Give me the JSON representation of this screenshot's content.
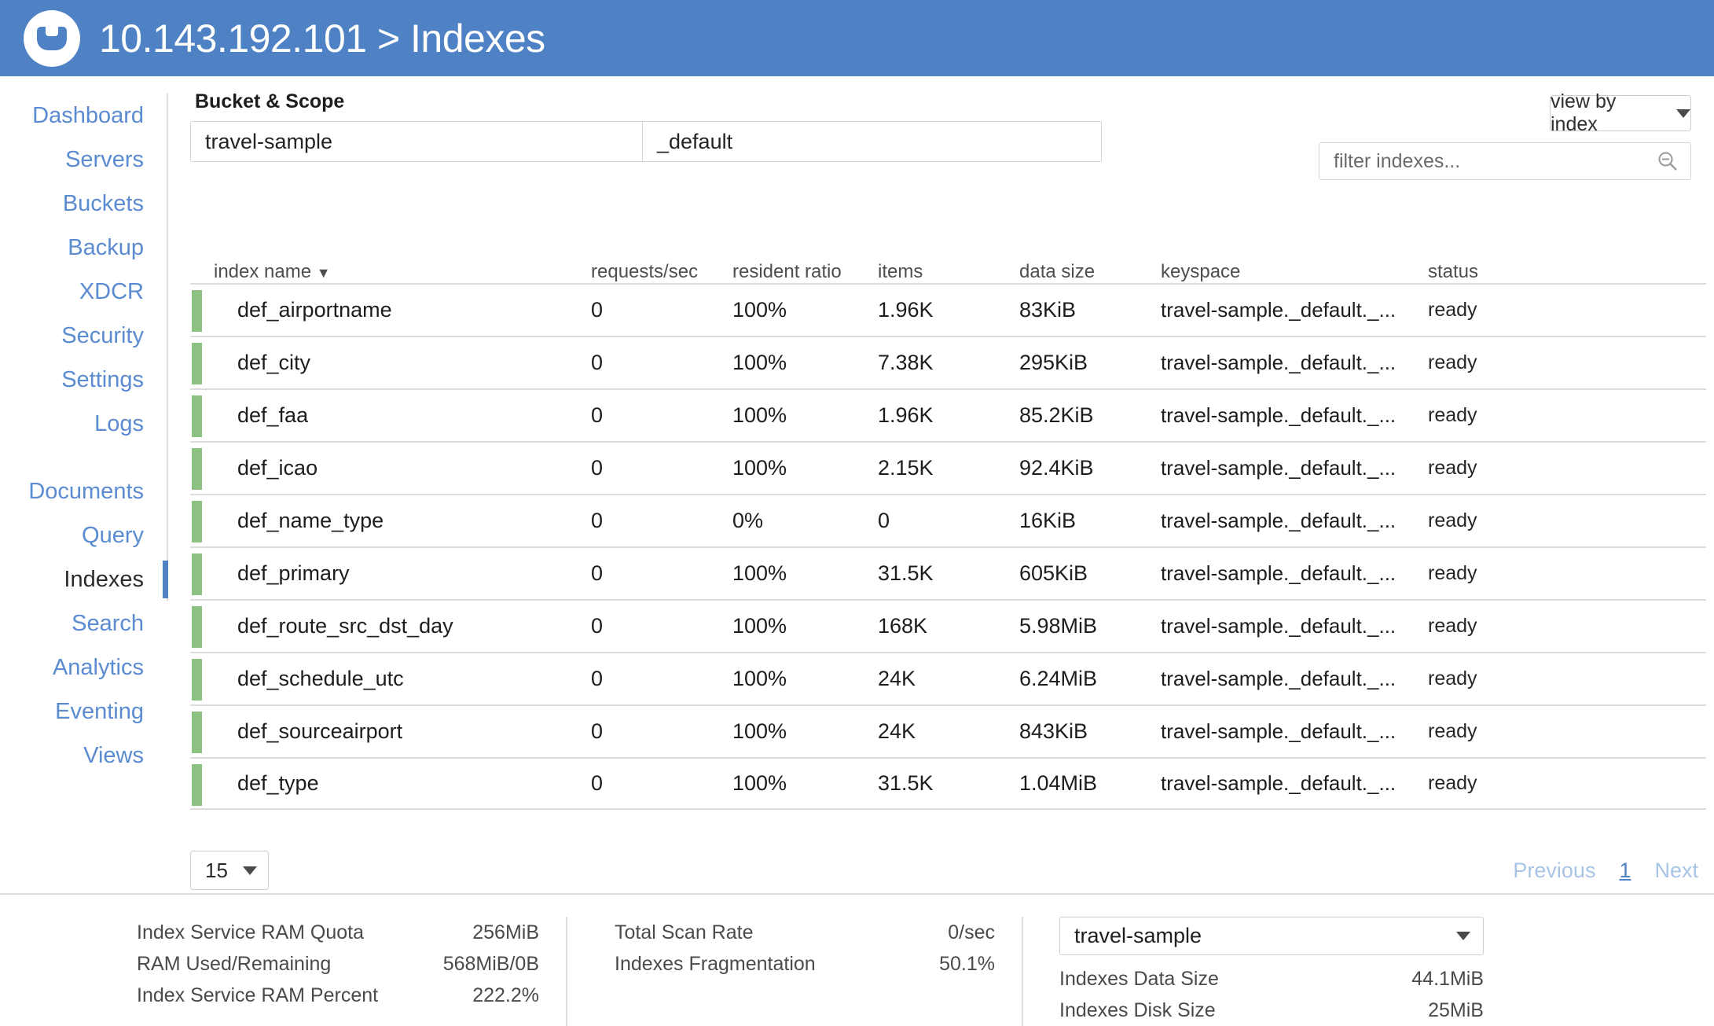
{
  "header": {
    "title": "10.143.192.101 > Indexes",
    "logo_icon": "couchbase-logo-icon",
    "bg_color": "#4f82c4"
  },
  "sidebar": {
    "group1": [
      {
        "label": "Dashboard",
        "active": false
      },
      {
        "label": "Servers",
        "active": false
      },
      {
        "label": "Buckets",
        "active": false
      },
      {
        "label": "Backup",
        "active": false
      },
      {
        "label": "XDCR",
        "active": false
      },
      {
        "label": "Security",
        "active": false
      },
      {
        "label": "Settings",
        "active": false
      },
      {
        "label": "Logs",
        "active": false
      }
    ],
    "group2": [
      {
        "label": "Documents",
        "active": false
      },
      {
        "label": "Query",
        "active": false
      },
      {
        "label": "Indexes",
        "active": true
      },
      {
        "label": "Search",
        "active": false
      },
      {
        "label": "Analytics",
        "active": false
      },
      {
        "label": "Eventing",
        "active": false
      },
      {
        "label": "Views",
        "active": false
      }
    ]
  },
  "controls": {
    "bucket_scope_label": "Bucket & Scope",
    "bucket_value": "travel-sample",
    "scope_value": "_default",
    "view_by_label": "view by index",
    "filter_placeholder": "filter indexes...",
    "filter_value": "",
    "search_icon": "search-icon"
  },
  "table": {
    "columns": [
      "index name",
      "requests/sec",
      "resident ratio",
      "items",
      "data size",
      "keyspace",
      "status"
    ],
    "sort_indicator": "▼",
    "status_color": "#8cc182",
    "rows": [
      {
        "name": "def_airportname",
        "requests": "0",
        "resident": "100%",
        "items": "1.96K",
        "size": "83KiB",
        "keyspace": "travel-sample._default._...",
        "status": "ready"
      },
      {
        "name": "def_city",
        "requests": "0",
        "resident": "100%",
        "items": "7.38K",
        "size": "295KiB",
        "keyspace": "travel-sample._default._...",
        "status": "ready"
      },
      {
        "name": "def_faa",
        "requests": "0",
        "resident": "100%",
        "items": "1.96K",
        "size": "85.2KiB",
        "keyspace": "travel-sample._default._...",
        "status": "ready"
      },
      {
        "name": "def_icao",
        "requests": "0",
        "resident": "100%",
        "items": "2.15K",
        "size": "92.4KiB",
        "keyspace": "travel-sample._default._...",
        "status": "ready"
      },
      {
        "name": "def_name_type",
        "requests": "0",
        "resident": "0%",
        "items": "0",
        "size": "16KiB",
        "keyspace": "travel-sample._default._...",
        "status": "ready"
      },
      {
        "name": "def_primary",
        "requests": "0",
        "resident": "100%",
        "items": "31.5K",
        "size": "605KiB",
        "keyspace": "travel-sample._default._...",
        "status": "ready"
      },
      {
        "name": "def_route_src_dst_day",
        "requests": "0",
        "resident": "100%",
        "items": "168K",
        "size": "5.98MiB",
        "keyspace": "travel-sample._default._...",
        "status": "ready"
      },
      {
        "name": "def_schedule_utc",
        "requests": "0",
        "resident": "100%",
        "items": "24K",
        "size": "6.24MiB",
        "keyspace": "travel-sample._default._...",
        "status": "ready"
      },
      {
        "name": "def_sourceairport",
        "requests": "0",
        "resident": "100%",
        "items": "24K",
        "size": "843KiB",
        "keyspace": "travel-sample._default._...",
        "status": "ready"
      },
      {
        "name": "def_type",
        "requests": "0",
        "resident": "100%",
        "items": "31.5K",
        "size": "1.04MiB",
        "keyspace": "travel-sample._default._...",
        "status": "ready"
      }
    ]
  },
  "pagination": {
    "page_size": "15",
    "previous_label": "Previous",
    "current_page": "1",
    "next_label": "Next"
  },
  "footer": {
    "col1": [
      {
        "label": "Index Service RAM Quota",
        "value": "256MiB"
      },
      {
        "label": "RAM Used/Remaining",
        "value": "568MiB/0B"
      },
      {
        "label": "Index Service RAM Percent",
        "value": "222.2%"
      }
    ],
    "col2": [
      {
        "label": "Total Scan Rate",
        "value": "0/sec"
      },
      {
        "label": "Indexes Fragmentation",
        "value": "50.1%"
      }
    ],
    "bucket_select": "travel-sample",
    "col3": [
      {
        "label": "Indexes Data Size",
        "value": "44.1MiB"
      },
      {
        "label": "Indexes Disk Size",
        "value": "25MiB"
      }
    ]
  }
}
